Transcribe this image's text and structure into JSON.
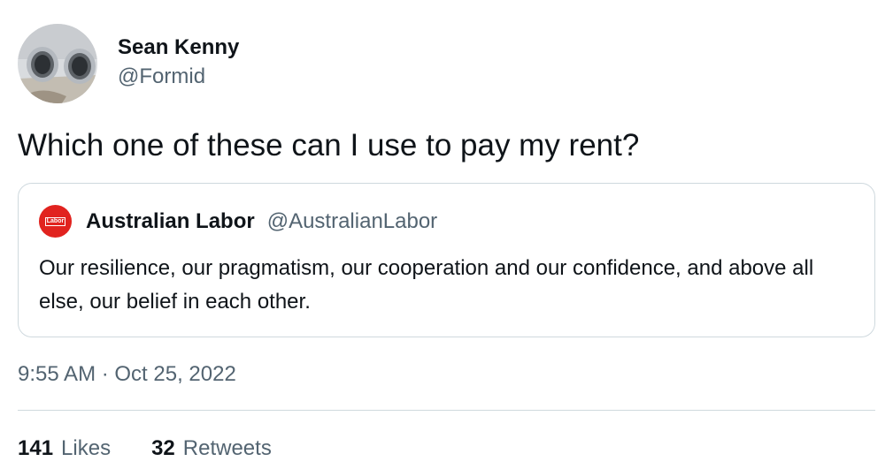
{
  "author": {
    "name": "Sean Kenny",
    "handle": "@Formid"
  },
  "tweet": {
    "text": "Which one of these can I use to pay my rent?",
    "timestamp": "9:55 AM · Oct 25, 2022"
  },
  "quoted_tweet": {
    "avatar_logo_text": "Labor",
    "name": "Australian Labor",
    "handle": "@AustralianLabor",
    "text": "Our resilience, our pragmatism, our cooperation and our confidence, and above all else, our belief in each other."
  },
  "stats": {
    "likes_count": "141",
    "likes_label": "Likes",
    "retweets_count": "32",
    "retweets_label": "Retweets"
  },
  "colors": {
    "primary_text": "#0f1419",
    "secondary_text": "#536471",
    "border": "#cfd9de",
    "labor_red": "#e1231f"
  }
}
